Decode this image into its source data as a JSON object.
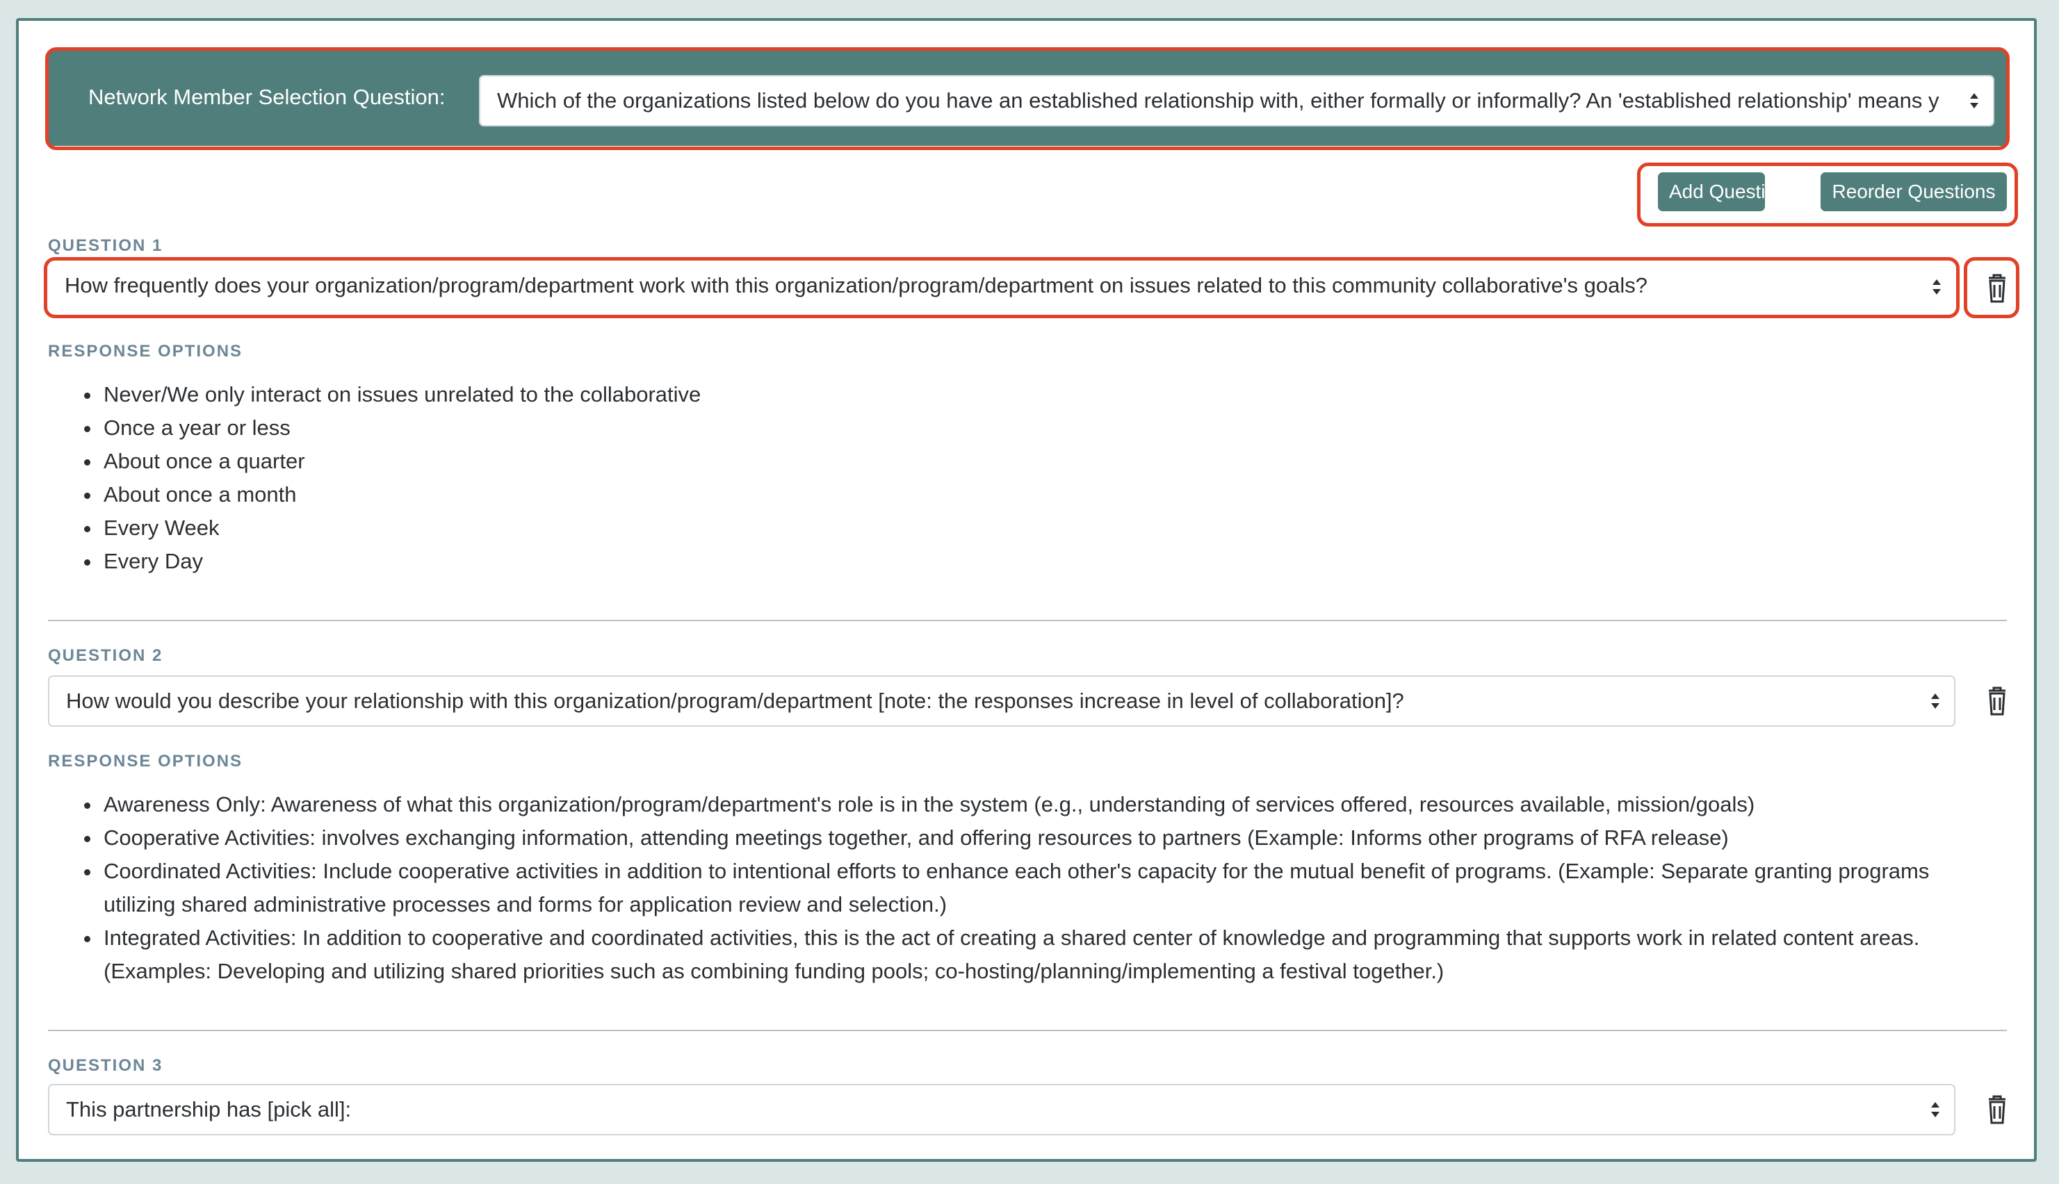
{
  "network_member": {
    "label": "Network Member Selection Question:",
    "value": "Which of the organizations listed below do you have an established relationship with, either formally or informally? An 'established relationship' means y"
  },
  "toolbar": {
    "add_label": "Add Question",
    "reorder_label": "Reorder Questions"
  },
  "questions": [
    {
      "label": "QUESTION 1",
      "value": "How frequently does your organization/program/department work with this organization/program/department on issues related to this community collaborative's goals?",
      "options_label": "RESPONSE OPTIONS",
      "options": [
        "Never/We only interact on issues unrelated to the collaborative",
        "Once a year or less",
        "About once a quarter",
        "About once a month",
        "Every Week",
        "Every Day"
      ]
    },
    {
      "label": "QUESTION 2",
      "value": "How would you describe your relationship with this organization/program/department [note: the responses increase in level of collaboration]?",
      "options_label": "RESPONSE OPTIONS",
      "options": [
        "Awareness Only: Awareness of what this organization/program/department's role is in the system (e.g., understanding of services offered, resources available, mission/goals)",
        "Cooperative Activities: involves exchanging information, attending meetings together, and offering resources to partners (Example: Informs other programs of RFA release)",
        "Coordinated Activities: Include cooperative activities in addition to intentional efforts to enhance each other's capacity for the mutual benefit of programs. (Example: Separate granting programs utilizing shared administrative processes and forms for application review and selection.)",
        "Integrated Activities: In addition to cooperative and coordinated activities, this is the act of creating a shared center of knowledge and programming that supports work in related content areas. (Examples: Developing and utilizing shared priorities such as combining funding pools; co-hosting/planning/implementing a festival together.)"
      ]
    },
    {
      "label": "QUESTION 3",
      "value": "This partnership has [pick all]:"
    }
  ],
  "colors": {
    "accent": "#4f7e7b",
    "highlight": "#e04127",
    "label": "#6c8696"
  }
}
